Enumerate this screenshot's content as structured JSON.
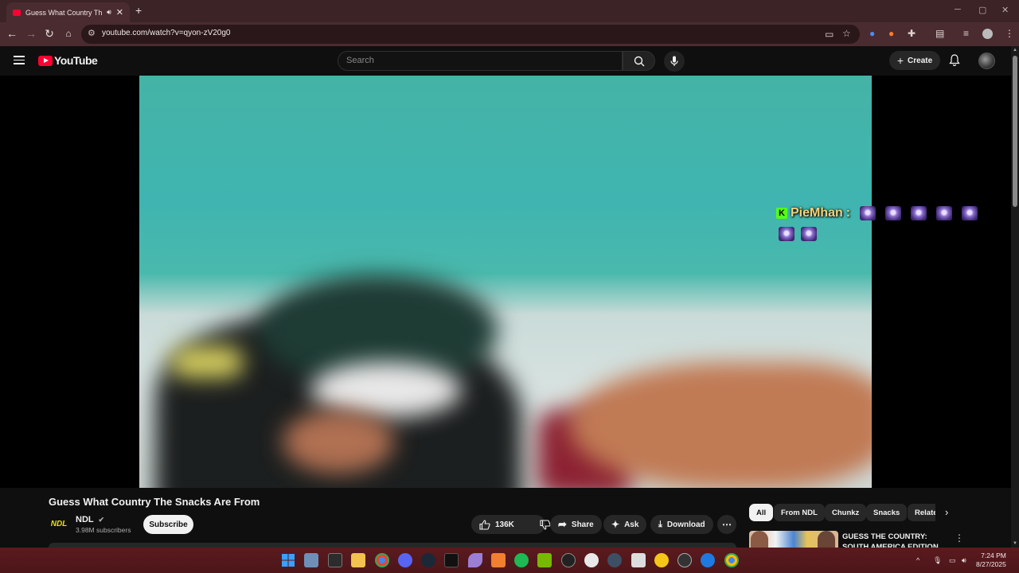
{
  "browser": {
    "tab_title": "Guess What Country The Snacks Are From",
    "url": "youtube.com/watch?v=qyon-zV20g0"
  },
  "youtube": {
    "logo_text": "YouTube",
    "search_placeholder": "Search",
    "create_label": "Create"
  },
  "video": {
    "chat_user": "PieMhan",
    "chat_sep": ":",
    "kick_badge": "K",
    "title": "Guess What Country The Snacks Are From",
    "channel_name": "NDL",
    "channel_subs": "3.98M subscribers",
    "subscribe_label": "Subscribe",
    "like_count": "136K",
    "share_label": "Share",
    "ask_label": "Ask",
    "download_label": "Download"
  },
  "chips": [
    "All",
    "From NDL",
    "Chunkz",
    "Snacks",
    "Relate"
  ],
  "recommendation": {
    "title": "GUESS THE COUNTRY: SOUTH AMERICA EDITION"
  },
  "taskbar": {
    "time": "7:24 PM",
    "date": "8/27/2025"
  },
  "colors": {
    "tabbar_bg": "#3b2326",
    "toolbar_bg": "#4a2c30",
    "youtube_red": "#ff0033",
    "taskbar_bg": "#5a1a1e"
  }
}
